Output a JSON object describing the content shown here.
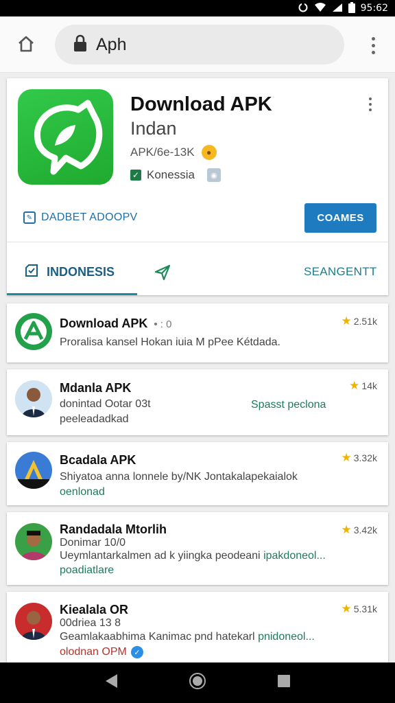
{
  "status_bar": {
    "time": "95:62"
  },
  "toolbar": {
    "url": "Aph"
  },
  "header": {
    "title": "Download APK",
    "subtitle": "Indan",
    "meta": "APK/6e-13K",
    "region": "Konessia",
    "addon_label": "DADBET ADOOPV",
    "primary_button": "COAMES",
    "tab_left": "INDONESIS",
    "tab_right": "SEANGENTT"
  },
  "items": [
    {
      "title": "Download APK",
      "title_extra": "• : 0",
      "rating": "2.51k",
      "line1": "Proralisa kansel Hokan iuia M pPee Kétdada."
    },
    {
      "title": "Mdanla APK",
      "rating": "14k",
      "line1": "donintad Ootar 03t",
      "line1_extra": "Spasst peclona",
      "line2": "peeleadadkad"
    },
    {
      "title": "Bcadala APK",
      "rating": "3.32k",
      "line1": "Shiyatoa anna lonnele by/NK Jontakalapekaialok",
      "line2": "oenlonad"
    },
    {
      "title": "Randadala Mtorlih",
      "rating": "3.42k",
      "line1": "Donimar 10/0",
      "line2": "Ueymlantarkalmen ad k yiingka peodeani",
      "line2_extra": "ipakdoneol...",
      "line3": "poadiatlare"
    },
    {
      "title": "Kiealala OR",
      "rating": "5.31k",
      "line1": "00driea 13 8",
      "line2": "Geamlakaabhima Kanimac pnd hatekarl",
      "line2_extra": "pnidoneol...",
      "line3": "olodnan OPM"
    }
  ],
  "colors": {
    "accent_blue": "#1f7bc0",
    "app_green": "#2bb843",
    "teal": "#1c7d8e",
    "star": "#f0b400"
  },
  "icons": [
    "home-icon",
    "lock-icon",
    "more-vert-icon",
    "emoji-icon",
    "check-icon",
    "badge-icon",
    "edit-icon",
    "indonesia-tab-icon",
    "send-icon",
    "star-icon",
    "verified-icon",
    "back-nav-icon",
    "home-nav-icon",
    "recents-nav-icon"
  ]
}
